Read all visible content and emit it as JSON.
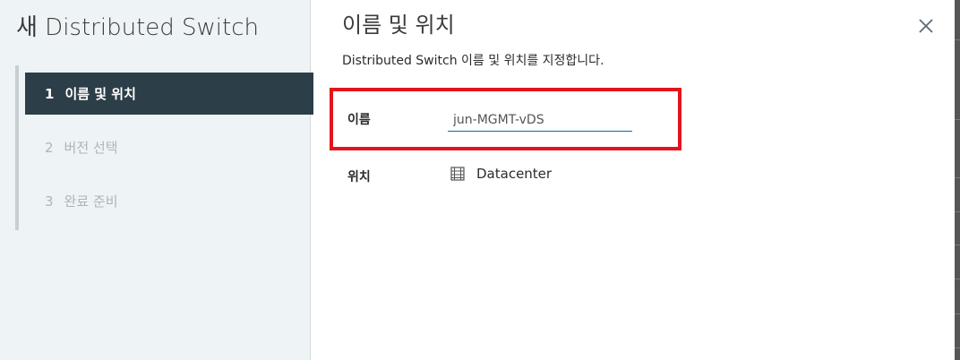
{
  "wizard": {
    "title": "새 Distributed Switch",
    "steps": [
      {
        "number": "1",
        "label": "이름 및 위치",
        "state": "active"
      },
      {
        "number": "2",
        "label": "버전 선택",
        "state": "pending"
      },
      {
        "number": "3",
        "label": "완료 준비",
        "state": "pending"
      }
    ]
  },
  "page": {
    "title": "이름 및 위치",
    "description": "Distributed Switch 이름 및 위치를 지정합니다.",
    "close_icon": "close-icon"
  },
  "form": {
    "name_label": "이름",
    "name_value": "jun-MGMT-vDS",
    "location_label": "위치",
    "location_value": "Datacenter",
    "location_icon": "datacenter-icon"
  },
  "colors": {
    "active_step_bg": "#2c3e48",
    "highlight_border": "#e3141b",
    "input_underline": "#0072a3"
  }
}
